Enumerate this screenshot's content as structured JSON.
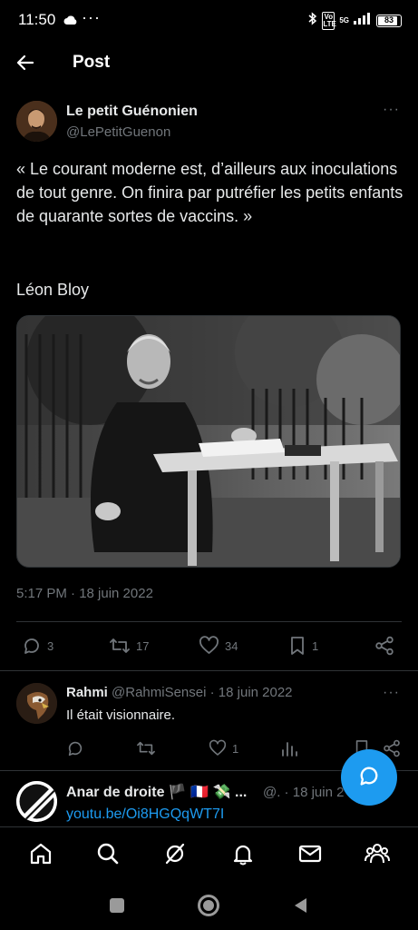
{
  "status_bar": {
    "time": "11:50",
    "dots": "···",
    "lte": "Vo LTE",
    "network": "5G",
    "battery": "83"
  },
  "header": {
    "title": "Post"
  },
  "tweet": {
    "author_name": "Le petit Guénonien",
    "author_handle": "@LePetitGuenon",
    "more": "···",
    "text": "« Le courant moderne est, d’ailleurs aux inoculations de tout genre. On finira par putréfier les petits enfants de quarante sortes de vaccins. »",
    "attribution": "Léon Bloy",
    "timestamp": "5:17 PM · 18 juin 2022",
    "replies": "3",
    "reposts": "17",
    "likes": "34",
    "bookmarks": "1"
  },
  "replies": [
    {
      "name": "Rahmi",
      "handle": "@RahmiSensei",
      "date": "· 18 juin 2022",
      "more": "···",
      "text": "Il était visionnaire.",
      "likes": "1"
    },
    {
      "name": "Anar de droite 🏴 🇫🇷 💸 ...",
      "meta": "@. · 18 juin 2",
      "link": "youtu.be/Oi8HGQqWT7I"
    }
  ],
  "colors": {
    "accent": "#1d9bf0",
    "muted": "#71767b",
    "divider": "#2f3336",
    "text": "#e7e9ea"
  }
}
